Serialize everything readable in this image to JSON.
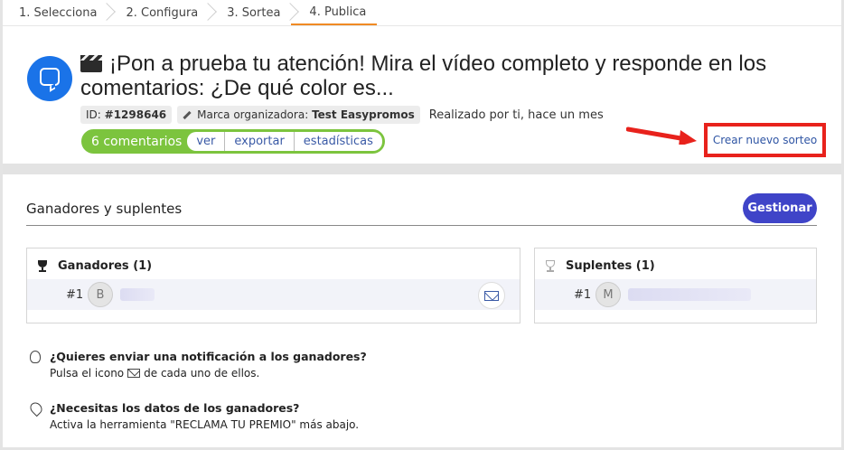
{
  "steps": [
    "1. Selecciona",
    "2. Configura",
    "3. Sortea",
    "4. Publica"
  ],
  "active_step": 3,
  "post": {
    "title": "¡Pon a prueba tu atención! Mira el vídeo completo y responde en los comentarios: ¿De qué color es...",
    "id_label": "ID:",
    "id_value": "#1298646",
    "brand_label": "Marca organizadora:",
    "brand_value": "Test Easypromos",
    "realized": "Realizado por ti, hace un mes"
  },
  "comments": {
    "count": "6 comentarios",
    "links": [
      "ver",
      "exportar",
      "estadísticas"
    ]
  },
  "new_draw_label": "Crear nuevo sorteo",
  "section": {
    "title": "Ganadores y suplentes",
    "manage_label": "Gestionar"
  },
  "winners": {
    "title": "Ganadores (1)",
    "rows": [
      {
        "num": "#1",
        "initial": "B"
      }
    ]
  },
  "substitutes": {
    "title": "Suplentes (1)",
    "rows": [
      {
        "num": "#1",
        "initial": "M"
      }
    ]
  },
  "tips": {
    "notify_q": "¿Quieres enviar una notificación a los ganadores?",
    "notify_a_pre": "Pulsa el icono",
    "notify_a_post": "de cada uno de ellos.",
    "data_q": "¿Necesitas los datos de los ganadores?",
    "data_a": "Activa la herramienta \"RECLAMA TU PREMIO\" más abajo."
  },
  "colors": {
    "accent_orange": "#f08a24",
    "avatar_blue": "#1a73e8",
    "comments_green": "#7cc43e",
    "manage_button": "#3f44c8",
    "highlight_red": "#e8221c",
    "link_blue": "#3a5aa6"
  }
}
